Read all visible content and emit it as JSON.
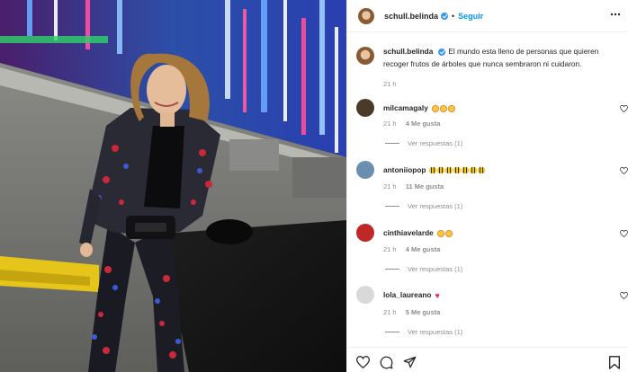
{
  "post": {
    "username": "schull.belinda",
    "follow_label": "Seguir",
    "separator": "•",
    "caption": "El mundo esta lleno de personas que quieren recoger frutos de árboles que nunca sembraron ni cuidaron.",
    "caption_time": "21 h"
  },
  "comments": [
    {
      "username": "milcamagaly",
      "emoji": [
        "star",
        "star",
        "star"
      ],
      "time": "21 h",
      "likes": "4 Me gusta",
      "replies": "Ver respuestas (1)",
      "avatar_color": "#4a3a2a"
    },
    {
      "username": "antoniiopop",
      "emoji": [
        "bee",
        "bee",
        "bee",
        "bee",
        "bee",
        "bee",
        "bee"
      ],
      "time": "21 h",
      "likes": "11 Me gusta",
      "replies": "Ver respuestas (1)",
      "avatar_color": "#6b8fb0"
    },
    {
      "username": "cinthiavelarde",
      "emoji": [
        "star",
        "star"
      ],
      "time": "21 h",
      "likes": "4 Me gusta",
      "replies": "Ver respuestas (1)",
      "avatar_color": "#c02828"
    },
    {
      "username": "lola_laureano",
      "emoji": [
        "red-heart"
      ],
      "time": "21 h",
      "likes": "5 Me gusta",
      "replies": "Ver respuestas (1)",
      "avatar_color": "#d9d9d9"
    }
  ],
  "actions": [
    "heart-icon",
    "comment-icon",
    "share-icon",
    "bookmark-icon"
  ],
  "colors": {
    "accent": "#0095f6",
    "verified": "#3897f0",
    "muted": "#8e8e8e",
    "text": "#262626"
  }
}
